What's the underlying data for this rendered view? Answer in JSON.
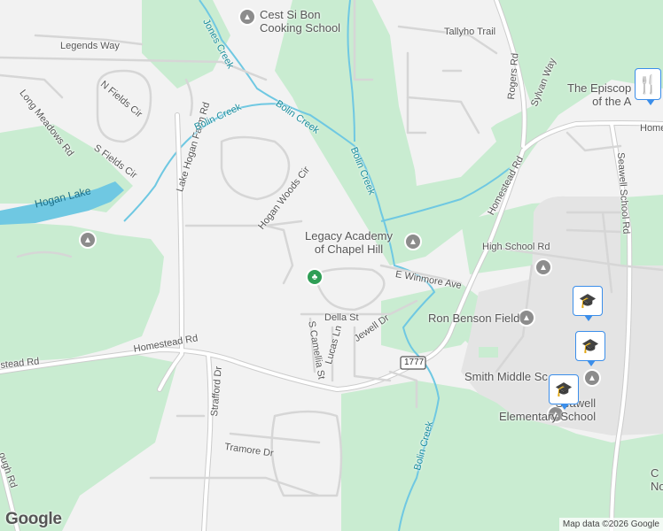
{
  "colors": {
    "park": "#c9ecd1",
    "water": "#6fc8e2",
    "road": "#ffffff",
    "road_casing": "#c9c9c9",
    "bg": "#f2f2f2"
  },
  "roads": {
    "legends_way": "Legends Way",
    "long_meadows": "Long Meadows Rd",
    "n_fields": "N Fields Cir",
    "s_fields": "S Fields Cir",
    "lake_hogan_farm": "Lake Hogan Farm Rd",
    "hogan_woods": "Hogan Woods Cir",
    "tallyho": "Tallyho Trail",
    "rogers": "Rogers Rd",
    "sylvan": "Sylvan Way",
    "homestead_ne": "Homestead Rd",
    "homestead_sw": "Homestead Rd",
    "homestead_w": "stead Rd",
    "homestead_e": "Home",
    "seawell": "Seawell School Rd",
    "high_school": "High School Rd",
    "e_winmore": "E Winmore Ave",
    "della": "Della St",
    "jewell": "Jewell Dr",
    "lucas": "Lucas Ln",
    "s_camellia": "S Camellia St",
    "strafford": "Strafford Dr",
    "tramore": "Tramore Dr",
    "borough": "ough Rd",
    "route": "1777"
  },
  "water": {
    "jones_creek": "Jones Creek",
    "bolin_1": "Bolin Creek",
    "bolin_2": "Bolin Creek",
    "bolin_3": "Bolin Creek",
    "bolin_4": "Bolin Creek",
    "hogan_lake": "Hogan Lake"
  },
  "pois": {
    "cooking_line1": "Cest Si Bon",
    "cooking_line2": "Cooking School",
    "legacy_line1": "Legacy Academy",
    "legacy_line2": "of Chapel Hill",
    "ron_benson": "Ron Benson Field",
    "smith": "Smith Middle Sc",
    "seawell_line1": "Seawell",
    "seawell_line2": "Elementary School",
    "episcopal_line1": "The Episcop",
    "episcopal_line2": "of the A",
    "cut_right_1": "C",
    "cut_right_2": "Nor"
  },
  "icons": {
    "school": "school-icon",
    "park": "park-icon",
    "restaurant": "restaurant-icon",
    "marker": "school-marker-icon"
  },
  "branding": {
    "logo": "Google",
    "attribution": "Map data ©2026 Google"
  }
}
